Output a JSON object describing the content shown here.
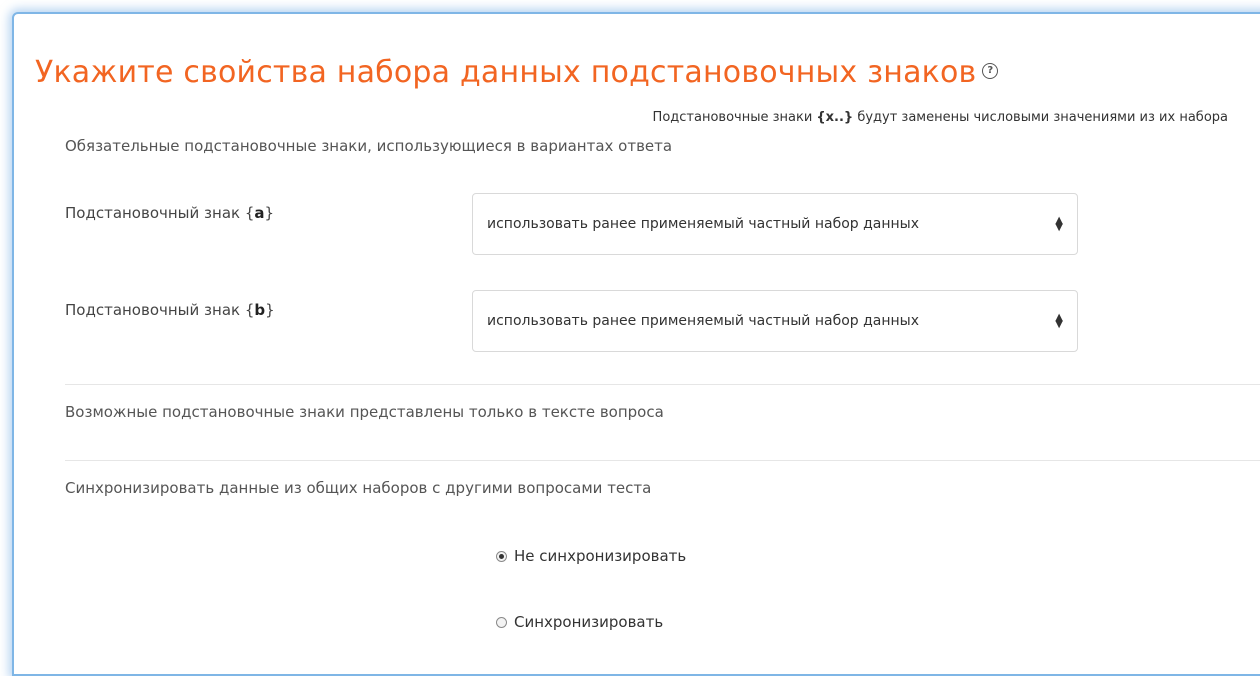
{
  "title": "Укажите свойства набора данных подстановочных знаков",
  "help_icon": "help-circle-icon",
  "hint": {
    "prefix": "Подстановочные знаки ",
    "code": "{x..}",
    "suffix": " будут заменены числовыми значениями из их набора"
  },
  "mandatory_section": "Обязательные подстановочные знаки, использующиеся в вариантах ответа",
  "wildcards": [
    {
      "label_prefix": "Подстановочный знак {",
      "name": "a",
      "label_suffix": "}",
      "selected": "использовать ранее применяемый частный набор данных"
    },
    {
      "label_prefix": "Подстановочный знак {",
      "name": "b",
      "label_suffix": "}",
      "selected": "использовать ранее применяемый частный набор данных"
    }
  ],
  "possible_section": "Возможные подстановочные знаки представлены только в тексте вопроса",
  "sync_section": "Синхронизировать данные из общих наборов с другими вопросами теста",
  "sync_options": [
    {
      "label": "Не синхронизировать",
      "checked": true
    },
    {
      "label": "Синхронизировать",
      "checked": false
    }
  ],
  "colors": {
    "title": "#f26522",
    "frame_border": "#7fb6e6"
  }
}
